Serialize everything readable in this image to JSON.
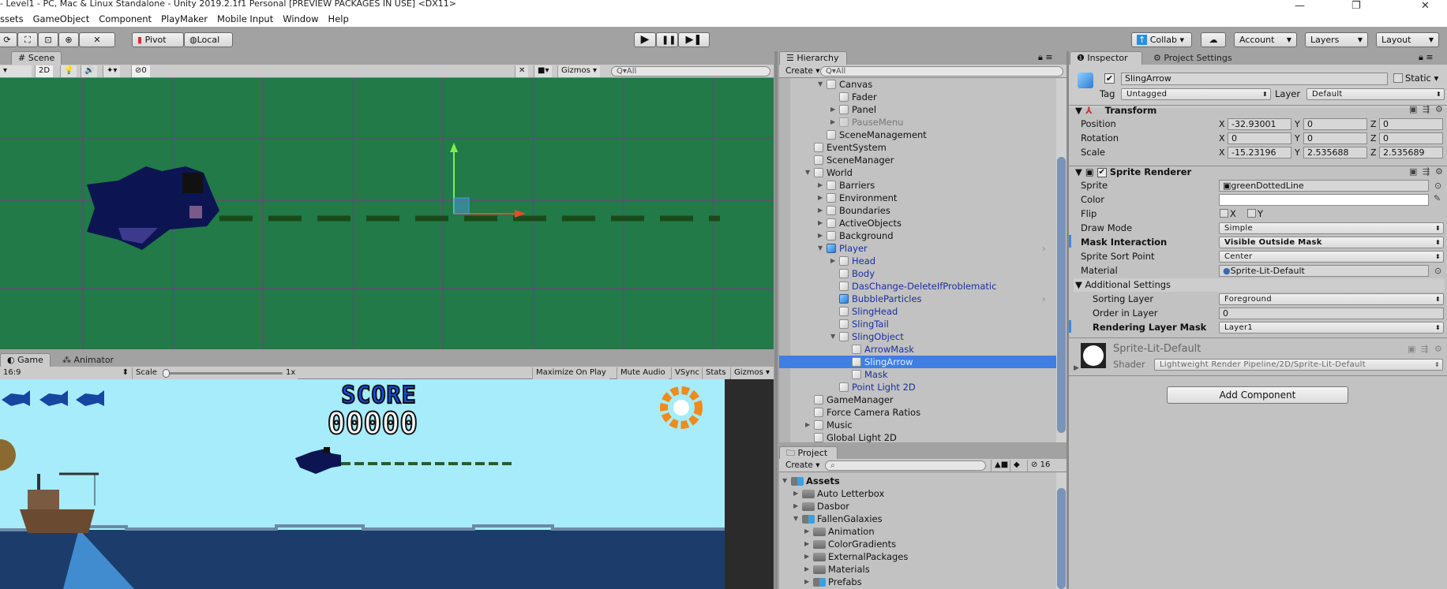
{
  "window": {
    "title": "- Level1 - PC, Mac & Linux Standalone - Unity 2019.2.1f1 Personal [PREVIEW PACKAGES IN USE] <DX11>",
    "controls": [
      "—",
      "❐",
      "✕"
    ]
  },
  "menu": [
    "ssets",
    "GameObject",
    "Component",
    "PlayMaker",
    "Mobile Input",
    "Window",
    "Help"
  ],
  "toolbar": {
    "tools": [
      "⟳",
      "⛶",
      "⊡",
      "⊕",
      "✕"
    ],
    "pivot": "Pivot",
    "local": "Local",
    "collab": "Collab ▾",
    "account": "Account",
    "layers": "Layers",
    "layout": "Layout",
    "cloud": "☁"
  },
  "scene": {
    "tab": "Scene",
    "mode_2d": "2D",
    "hidden_count": "0",
    "gizmos": "Gizmos",
    "search_placeholder": "All",
    "bg": "#217a47",
    "grid": "#7a3a8a"
  },
  "game": {
    "tab": "Game",
    "animator_tab": "Animator",
    "aspect": "16:9",
    "scale_label": "Scale",
    "scale_value": "1x",
    "scale_fraction": 0,
    "buttons": [
      "Maximize On Play",
      "Mute Audio",
      "VSync",
      "Stats",
      "Gizmos"
    ],
    "score_label": "SCORE",
    "score_value": "00000",
    "lives": 3,
    "sky": "#a6ecfb",
    "sea": "#1c3d6b"
  },
  "hierarchy": {
    "tab": "Hierarchy",
    "create": "Create",
    "search_placeholder": "All",
    "items": [
      {
        "label": "Canvas",
        "level": 1,
        "expand": "open",
        "kind": "go"
      },
      {
        "label": "Fader",
        "level": 2,
        "expand": "",
        "kind": "go"
      },
      {
        "label": "Panel",
        "level": 2,
        "expand": "closed",
        "kind": "go"
      },
      {
        "label": "PauseMenu",
        "level": 2,
        "expand": "closed",
        "kind": "disabled"
      },
      {
        "label": "SceneManagement",
        "level": 1,
        "expand": "",
        "kind": "go"
      },
      {
        "label": "EventSystem",
        "level": 0,
        "expand": "",
        "kind": "go"
      },
      {
        "label": "SceneManager",
        "level": 0,
        "expand": "",
        "kind": "go"
      },
      {
        "label": "World",
        "level": 0,
        "expand": "open",
        "kind": "go"
      },
      {
        "label": "Barriers",
        "level": 1,
        "expand": "closed",
        "kind": "go"
      },
      {
        "label": "Environment",
        "level": 1,
        "expand": "closed",
        "kind": "go"
      },
      {
        "label": "Boundaries",
        "level": 1,
        "expand": "closed",
        "kind": "go"
      },
      {
        "label": "ActiveObjects",
        "level": 1,
        "expand": "closed",
        "kind": "go"
      },
      {
        "label": "Background",
        "level": 1,
        "expand": "closed",
        "kind": "go"
      },
      {
        "label": "Player",
        "level": 1,
        "expand": "open",
        "kind": "prefab-root"
      },
      {
        "label": "Head",
        "level": 2,
        "expand": "closed",
        "kind": "prefab"
      },
      {
        "label": "Body",
        "level": 2,
        "expand": "",
        "kind": "prefab"
      },
      {
        "label": "DasChange-DeleteIfProblematic",
        "level": 2,
        "expand": "",
        "kind": "prefab"
      },
      {
        "label": "BubbleParticles",
        "level": 2,
        "expand": "",
        "kind": "prefab-root"
      },
      {
        "label": "SlingHead",
        "level": 2,
        "expand": "",
        "kind": "prefab"
      },
      {
        "label": "SlingTail",
        "level": 2,
        "expand": "",
        "kind": "prefab"
      },
      {
        "label": "SlingObject",
        "level": 2,
        "expand": "open",
        "kind": "prefab"
      },
      {
        "label": "ArrowMask",
        "level": 3,
        "expand": "",
        "kind": "prefab"
      },
      {
        "label": "SlingArrow",
        "level": 3,
        "expand": "",
        "kind": "prefab",
        "selected": true
      },
      {
        "label": "Mask",
        "level": 3,
        "expand": "",
        "kind": "prefab"
      },
      {
        "label": "Point Light 2D",
        "level": 2,
        "expand": "",
        "kind": "prefab"
      },
      {
        "label": "GameManager",
        "level": 0,
        "expand": "",
        "kind": "go"
      },
      {
        "label": "Force Camera Ratios",
        "level": 0,
        "expand": "",
        "kind": "go"
      },
      {
        "label": "Music",
        "level": 0,
        "expand": "closed",
        "kind": "go"
      },
      {
        "label": "Global Light 2D",
        "level": 0,
        "expand": "",
        "kind": "go"
      }
    ]
  },
  "project": {
    "tab": "Project",
    "create": "Create",
    "hidden_count": "16",
    "items": [
      {
        "label": "Assets",
        "level": 0,
        "expand": "open",
        "folder": "blue",
        "bold": true
      },
      {
        "label": "Auto Letterbox",
        "level": 1,
        "expand": "closed",
        "folder": "gray"
      },
      {
        "label": "Dasbor",
        "level": 1,
        "expand": "closed",
        "folder": "gray"
      },
      {
        "label": "FallenGalaxies",
        "level": 1,
        "expand": "open",
        "folder": "blue"
      },
      {
        "label": "Animation",
        "level": 2,
        "expand": "closed",
        "folder": "gray"
      },
      {
        "label": "ColorGradients",
        "level": 2,
        "expand": "closed",
        "folder": "gray"
      },
      {
        "label": "ExternalPackages",
        "level": 2,
        "expand": "closed",
        "folder": "gray"
      },
      {
        "label": "Materials",
        "level": 2,
        "expand": "closed",
        "folder": "gray"
      },
      {
        "label": "Prefabs",
        "level": 2,
        "expand": "closed",
        "folder": "blue"
      }
    ]
  },
  "inspector": {
    "tab": "Inspector",
    "settings_tab": "Project Settings",
    "name": "SlingArrow",
    "active": true,
    "static_label": "Static",
    "static": false,
    "tag_label": "Tag",
    "tag": "Untagged",
    "layer_label": "Layer",
    "layer": "Default",
    "transform": {
      "title": "Transform",
      "rows": [
        {
          "label": "Position",
          "x": "-32.93001",
          "y": "0",
          "z": "0"
        },
        {
          "label": "Rotation",
          "x": "0",
          "y": "0",
          "z": "0"
        },
        {
          "label": "Scale",
          "x": "-15.23196",
          "y": "2.535688",
          "z": "2.535689"
        }
      ]
    },
    "sprite_renderer": {
      "title": "Sprite Renderer",
      "enabled": true,
      "sprite_label": "Sprite",
      "sprite": "greenDottedLine",
      "color_label": "Color",
      "color": "#ffffff",
      "flip_label": "Flip",
      "flip_x": "X",
      "flip_y": "Y",
      "draw_mode_label": "Draw Mode",
      "draw_mode": "Simple",
      "mask_label": "Mask Interaction",
      "mask": "Visible Outside Mask",
      "sort_point_label": "Sprite Sort Point",
      "sort_point": "Center",
      "material_label": "Material",
      "material": "Sprite-Lit-Default",
      "additional": "Additional Settings",
      "sorting_layer_label": "Sorting Layer",
      "sorting_layer": "Foreground",
      "order_label": "Order in Layer",
      "order": "0",
      "rlm_label": "Rendering Layer Mask",
      "rlm": "Layer1"
    },
    "material": {
      "name": "Sprite-Lit-Default",
      "shader_label": "Shader",
      "shader": "Lightweight Render Pipeline/2D/Sprite-Lit-Default"
    },
    "add_component": "Add Component"
  }
}
